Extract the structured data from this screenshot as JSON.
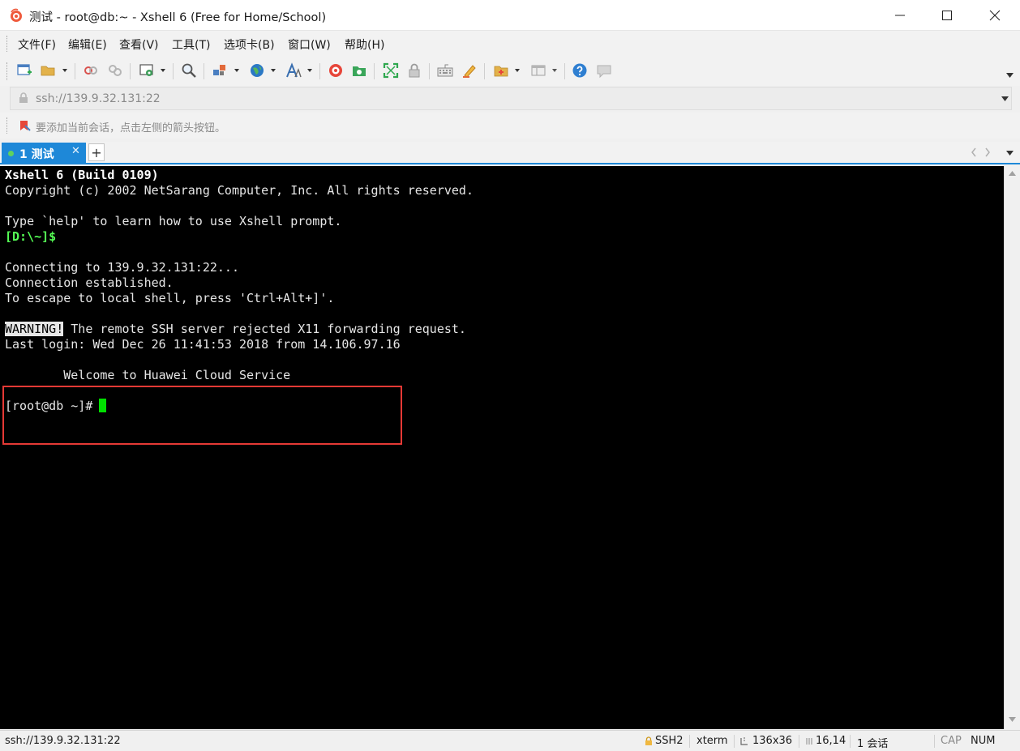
{
  "window": {
    "title": "测试 - root@db:~ - Xshell 6 (Free for Home/School)"
  },
  "menu": {
    "items": [
      "文件(F)",
      "编辑(E)",
      "查看(V)",
      "工具(T)",
      "选项卡(B)",
      "窗口(W)",
      "帮助(H)"
    ]
  },
  "toolbar": {
    "buttons": [
      "new-session-icon",
      "open-folder-icon",
      "reconnect-icon",
      "disconnect-icon",
      "properties-icon",
      "find-icon",
      "transfer-icon",
      "globe-icon",
      "font-icon",
      "xshell-icon",
      "xftp-icon",
      "fullscreen-icon",
      "lock-icon",
      "keyboard-icon",
      "highlight-pen-icon",
      "add-folder-icon",
      "layout-icon",
      "help-icon",
      "chat-icon"
    ]
  },
  "address": {
    "value": "ssh://139.9.32.131:22"
  },
  "hint": {
    "text": "要添加当前会话，点击左侧的箭头按钮。"
  },
  "tabs": [
    {
      "label": "1 测试",
      "active": true
    }
  ],
  "terminal": {
    "lines": [
      {
        "text": "Xshell 6 (Build 0109)",
        "style": "bold"
      },
      {
        "text": "Copyright (c) 2002 NetSarang Computer, Inc. All rights reserved.",
        "style": ""
      },
      {
        "text": "",
        "style": ""
      },
      {
        "text": "Type `help' to learn how to use Xshell prompt.",
        "style": ""
      },
      {
        "text": "[D:\\~]$",
        "style": "green"
      },
      {
        "text": "",
        "style": ""
      },
      {
        "text": "Connecting to 139.9.32.131:22...",
        "style": ""
      },
      {
        "text": "Connection established.",
        "style": ""
      },
      {
        "text": "To escape to local shell, press 'Ctrl+Alt+]'.",
        "style": ""
      },
      {
        "text": "",
        "style": ""
      },
      {
        "text": "WARNING!",
        "suffix": " The remote SSH server rejected X11 forwarding request.",
        "style": "warn"
      },
      {
        "text": "Last login: Wed Dec 26 11:41:53 2018 from 14.106.97.16",
        "style": ""
      },
      {
        "text": "",
        "style": ""
      },
      {
        "text": "        Welcome to Huawei Cloud Service",
        "style": ""
      },
      {
        "text": "",
        "style": ""
      },
      {
        "text": "[root@db ~]#",
        "style": "prompt"
      }
    ]
  },
  "status": {
    "address": "ssh://139.9.32.131:22",
    "protocol": "SSH2",
    "term_type": "xterm",
    "size": "136x36",
    "position": "16,14",
    "sessions": "1 会话",
    "cap": "CAP",
    "num": "NUM"
  },
  "colors": {
    "tab_accent": "#1e88d8",
    "terminal_bg": "#000000",
    "prompt_green": "#55ff55",
    "cursor_green": "#00e000",
    "highlight_red": "#e53935"
  }
}
